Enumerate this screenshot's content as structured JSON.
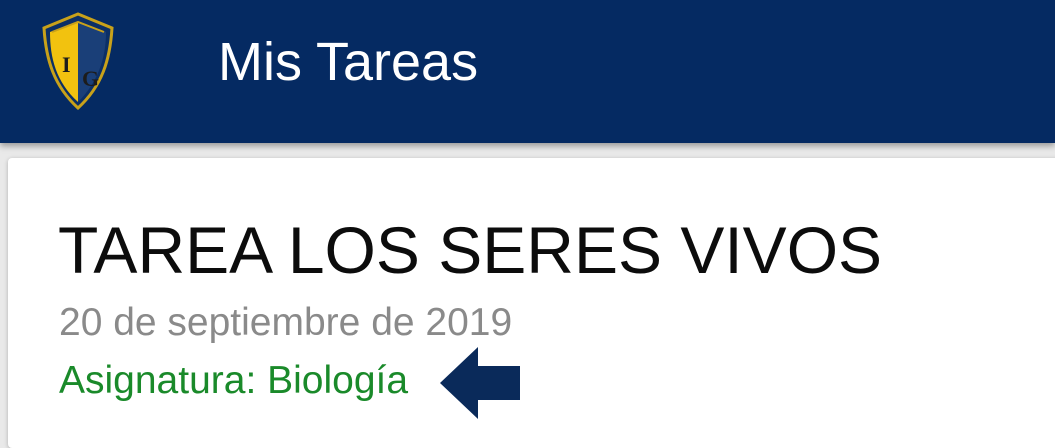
{
  "app_bar": {
    "logo_letters": "IG",
    "title": "Mis Tareas",
    "background": "#052a62"
  },
  "task": {
    "title": "TAREA LOS SERES VIVOS",
    "date": "20 de septiembre de 2019",
    "subject_label": "Asignatura: Biología",
    "subject_color": "#1a8a2a"
  },
  "annotation": {
    "icon": "arrow-left-icon",
    "color": "#0a2a5a"
  }
}
